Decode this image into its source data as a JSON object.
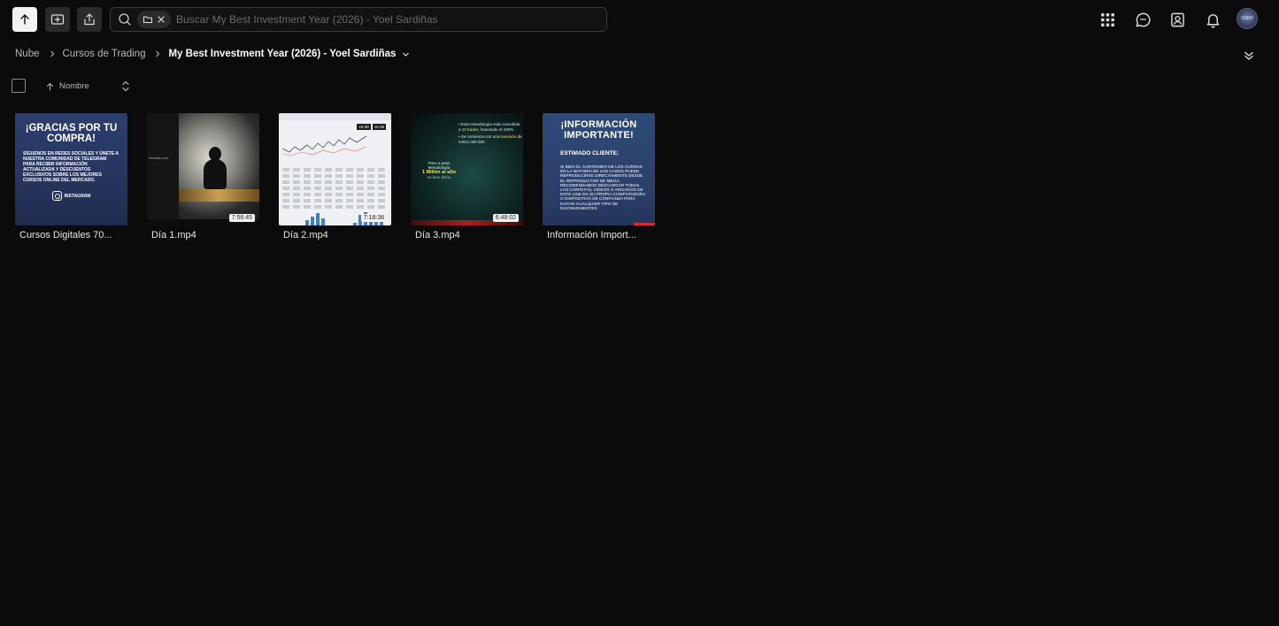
{
  "toolbar": {
    "upload_icon": "arrow-up-icon",
    "new_folder_icon": "folder-plus-icon",
    "share_icon": "share-icon"
  },
  "search": {
    "placeholder": "Buscar My Best Investment Year (2026) - Yoel Sardiñas",
    "value": "",
    "scope_chip_icon": "folder-icon",
    "scope_chip_close_icon": "close-icon"
  },
  "top_right": {
    "icons": [
      "apps-grid-icon",
      "chat-icon",
      "contacts-icon",
      "bell-icon"
    ],
    "avatar_text": "ΩSRD"
  },
  "breadcrumb": {
    "items": [
      "Nube",
      "Cursos de Trading"
    ],
    "current": "My Best Investment Year (2026) - Yoel Sardiñas"
  },
  "sort": {
    "label": "Nombre",
    "direction": "ascending"
  },
  "files": [
    {
      "name": "Cursos Digitales 70...",
      "thumb_title": "¡GRACIAS POR TU COMPRA!",
      "thumb_text": "SÍGUENOS EN REDES SOCIALES Y ÚNETE A NUESTRA COMUNIDAD DE TELEGRAM PARA RECIBIR INFORMACIÓN ACTUALIZADA Y DESCUENTOS EXCLUSIVOS SOBRE LOS MEJORES CURSOS ONLINE DEL MERCADO.",
      "thumb_social": "INSTAGRAM"
    },
    {
      "name": "Día 1.mp4",
      "duration": "7:56:45",
      "thumb_text": "mediado por"
    },
    {
      "name": "Día 2.mp4",
      "duration": "7:18:38",
      "thumb_prices": [
        "18.38",
        "18.38"
      ]
    },
    {
      "name": "Día 3.mp4",
      "duration": "6:48:02",
      "thumb_line1": "• Esta metodología está concebida a",
      "thumb_line1_em": "10 trades",
      "thumb_line1_tail": ", buscando el 100%",
      "thumb_line2": "• Se comienza con una",
      "thumb_line2_em": "inversión",
      "thumb_line2_tail": " de USD1.000.000",
      "thumb_caption": "Paso a paso",
      "thumb_caption2": "Metodología",
      "thumb_caption_em": "1 Millón al año",
      "thumb_caption3": "es bien dicho"
    },
    {
      "name": "Información Import...",
      "thumb_title": "¡INFORMACIÓN IMPORTANTE!",
      "thumb_sub": "ESTIMADO CLIENTE:",
      "thumb_text": "Si bien el contenido de los cursos en la mayoría de los casos puede reproducirse directamente desde el reproductor de Mega, recomendamos descargar todas las carpetas, videos o archivos de este link en su propia computadora o dispositivo de confianza para evitar cualquier tipo de inconvenientes."
    }
  ]
}
